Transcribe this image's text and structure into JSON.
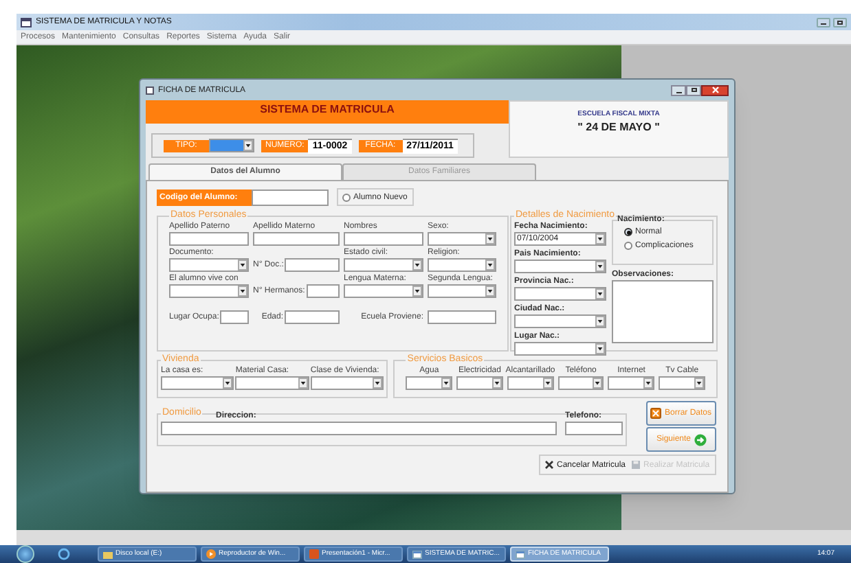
{
  "app": {
    "title": "SISTEMA DE MATRICULA Y NOTAS",
    "menu": [
      "Procesos",
      "Mantenimiento",
      "Consultas",
      "Reportes",
      "Sistema",
      "Ayuda",
      "Salir"
    ]
  },
  "dialog": {
    "title": "FICHA DE MATRICULA",
    "header": "SISTEMA DE MATRICULA",
    "school_type": "ESCUELA FISCAL MIXTA",
    "school_name": "\" 24 DE MAYO \"",
    "tipo": {
      "label": "TIPO:",
      "focused": true
    },
    "numero": {
      "label": "NUMERO:",
      "value": "11-0002"
    },
    "fecha": {
      "label": "FECHA:",
      "value": "27/11/2011"
    },
    "tabs": [
      {
        "label": "Datos del Alumno",
        "selected": true
      },
      {
        "label": "Datos Familiares",
        "selected": false
      }
    ],
    "codigo": {
      "label": "Codigo del Alumno:"
    },
    "alumno_nuevo": {
      "label": "Alumno Nuevo",
      "selected": false
    },
    "datos_personales": {
      "title": "Datos Personales",
      "rows": [
        [
          {
            "label": "Apellido Paterno",
            "kind": "text"
          },
          {
            "label": "Apellido Materno",
            "kind": "text"
          },
          {
            "label": "Nombres",
            "kind": "text"
          },
          {
            "label": "Sexo:",
            "kind": "combo"
          }
        ],
        [
          {
            "label": "Documento:",
            "kind": "combo"
          },
          {
            "inline": "N° Doc.:",
            "kind": "text"
          },
          {
            "label": "Estado civil:",
            "kind": "combo"
          },
          {
            "label": "Religion:",
            "kind": "combo"
          }
        ],
        [
          {
            "label": "El alumno vive con",
            "kind": "combo"
          },
          {
            "inline": "N° Hermanos:",
            "kind": "text"
          },
          {
            "label": "Lengua Materna:",
            "kind": "combo"
          },
          {
            "label": "Segunda Lengua:",
            "kind": "combo"
          }
        ],
        [
          {
            "inline": "Lugar Ocupa:",
            "kind": "text"
          },
          {
            "inline": "Edad:",
            "kind": "text"
          },
          {
            "text": "Ecuela Proviene:",
            "kind": "label"
          },
          {
            "kind": "text"
          }
        ]
      ]
    },
    "detalles_nacimiento": {
      "title": "Detalles de Nacimiento",
      "fields": [
        {
          "label": "Fecha Nacimiento:",
          "value": "07/10/2004"
        },
        {
          "label": "Pais Nacimiento:"
        },
        {
          "label": "Provincia Nac.:"
        },
        {
          "label": "Ciudad Nac.:"
        },
        {
          "label": "Lugar Nac.:"
        }
      ],
      "nacimiento": {
        "title": "Nacimiento:",
        "options": [
          {
            "label": "Normal",
            "selected": true
          },
          {
            "label": "Complicaciones",
            "selected": false
          }
        ]
      },
      "observaciones": {
        "label": "Observaciones:"
      }
    },
    "vivienda": {
      "title": "Vivienda",
      "fields": [
        {
          "label": "La casa es:"
        },
        {
          "label": "Material Casa:"
        },
        {
          "label": "Clase de Vivienda:"
        }
      ]
    },
    "servicios": {
      "title": "Servicios Basicos",
      "fields": [
        {
          "label": "Agua"
        },
        {
          "label": "Electricidad"
        },
        {
          "label": "Alcantarillado"
        },
        {
          "label": "Teléfono"
        },
        {
          "label": "Internet"
        },
        {
          "label": "Tv Cable"
        }
      ]
    },
    "domicilio": {
      "title": "Domicilio",
      "direccion": "Direccion:",
      "telefono": "Telefono:"
    },
    "buttons": [
      {
        "label": "Borrar Datos",
        "kind": "delete"
      },
      {
        "label": "Siguiente",
        "kind": "next"
      }
    ],
    "actions": [
      {
        "label": "Cancelar Matricula",
        "kind": "cancel",
        "disabled": false
      },
      {
        "label": "Realizar Matricula",
        "kind": "save",
        "disabled": true
      }
    ]
  },
  "taskbar": {
    "items": [
      {
        "label": "Disco local (E:)",
        "kind": "folder",
        "selected": false
      },
      {
        "label": "Reproductor de Win...",
        "kind": "media",
        "selected": false
      },
      {
        "label": "Presentación1 - Micr...",
        "kind": "slides",
        "selected": false
      },
      {
        "label": "SISTEMA DE MATRIC...",
        "kind": "app",
        "selected": false
      },
      {
        "label": "FICHA DE MATRICULA",
        "kind": "app",
        "selected": true
      }
    ],
    "clock": "14:07"
  }
}
